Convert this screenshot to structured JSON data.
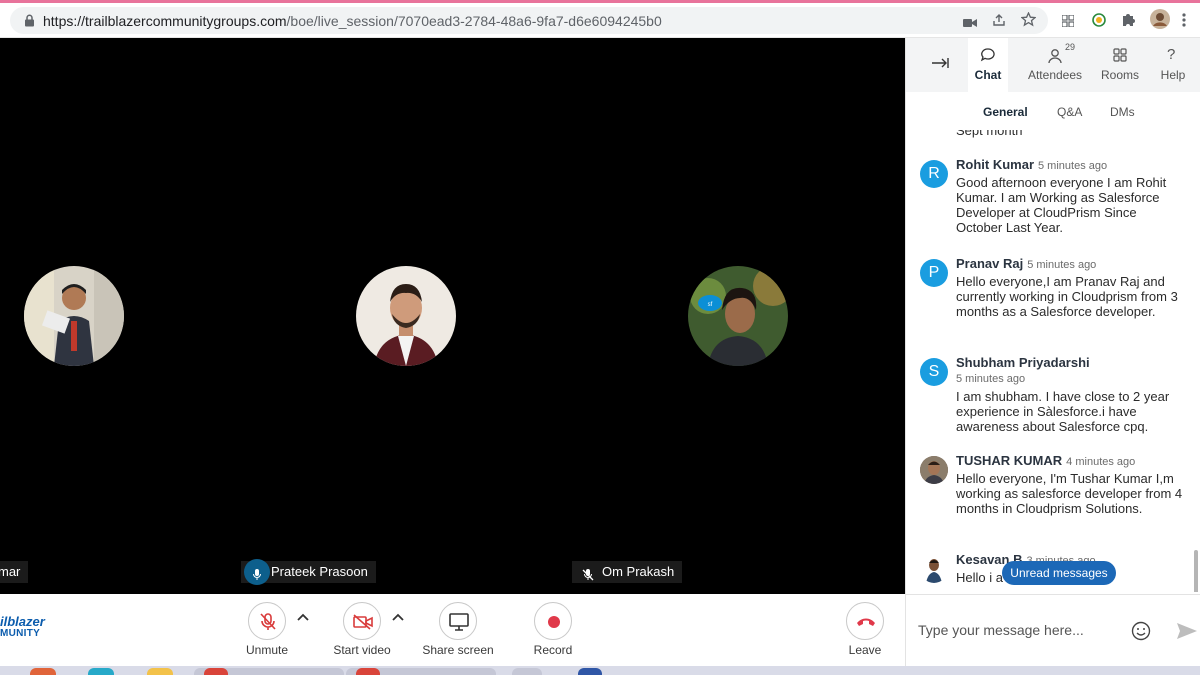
{
  "browser": {
    "url_host": "https://trailblazercommunitygroups.com",
    "url_path": "/boe/live_session/7070ead3-2784-48a6-9fa7-d6e6094245b0"
  },
  "stage": {
    "participants": [
      {
        "name": "mar"
      },
      {
        "name": "Prateek Prasoon"
      },
      {
        "name": "Om Prakash"
      }
    ]
  },
  "toolbar": {
    "logo_line1": "ilblazer",
    "logo_line2": "MUNITY",
    "unmute_label": "Unmute",
    "start_video_label": "Start video",
    "share_screen_label": "Share screen",
    "record_label": "Record",
    "leave_label": "Leave"
  },
  "panel": {
    "tabs": [
      {
        "label": "Chat"
      },
      {
        "label": "Attendees",
        "badge": "29"
      },
      {
        "label": "Rooms"
      },
      {
        "label": "Help"
      }
    ],
    "subtabs": [
      "General",
      "Q&A",
      "DMs"
    ],
    "cut_text": "Sept month",
    "messages": [
      {
        "initial": "R",
        "name": "Rohit Kumar",
        "time": "5 minutes ago",
        "text": "Good afternoon everyone I am Rohit Kumar. I am Working as Salesforce Developer at CloudPrism Since October Last Year."
      },
      {
        "initial": "P",
        "name": "Pranav Raj",
        "time": "5 minutes ago",
        "text": "Hello everyone,I am Pranav Raj and currently working in Cloudprism from 3 months as a Salesforce developer."
      },
      {
        "initial": "S",
        "name": "Shubham Priyadarshi",
        "time": "5 minutes ago",
        "text": "I am shubham. I have close to 2 year experience in Sàlesforce.i have awareness about Salesforce cpq."
      },
      {
        "initial": "",
        "name": "TUSHAR KUMAR",
        "time": "4 minutes ago",
        "text": "Hello everyone, I'm Tushar Kumar I,m working as salesforce developer from 4 months in Cloudprism Solutions."
      },
      {
        "initial": "",
        "name": "Kesavan B",
        "time": "3 minutes ago",
        "text": "Hello i a"
      }
    ],
    "unread_label": "Unread messages",
    "composer_placeholder": "Type your message here...",
    "colors": {
      "accent": "#1c68b7",
      "avatar": "#1a9de0"
    }
  }
}
